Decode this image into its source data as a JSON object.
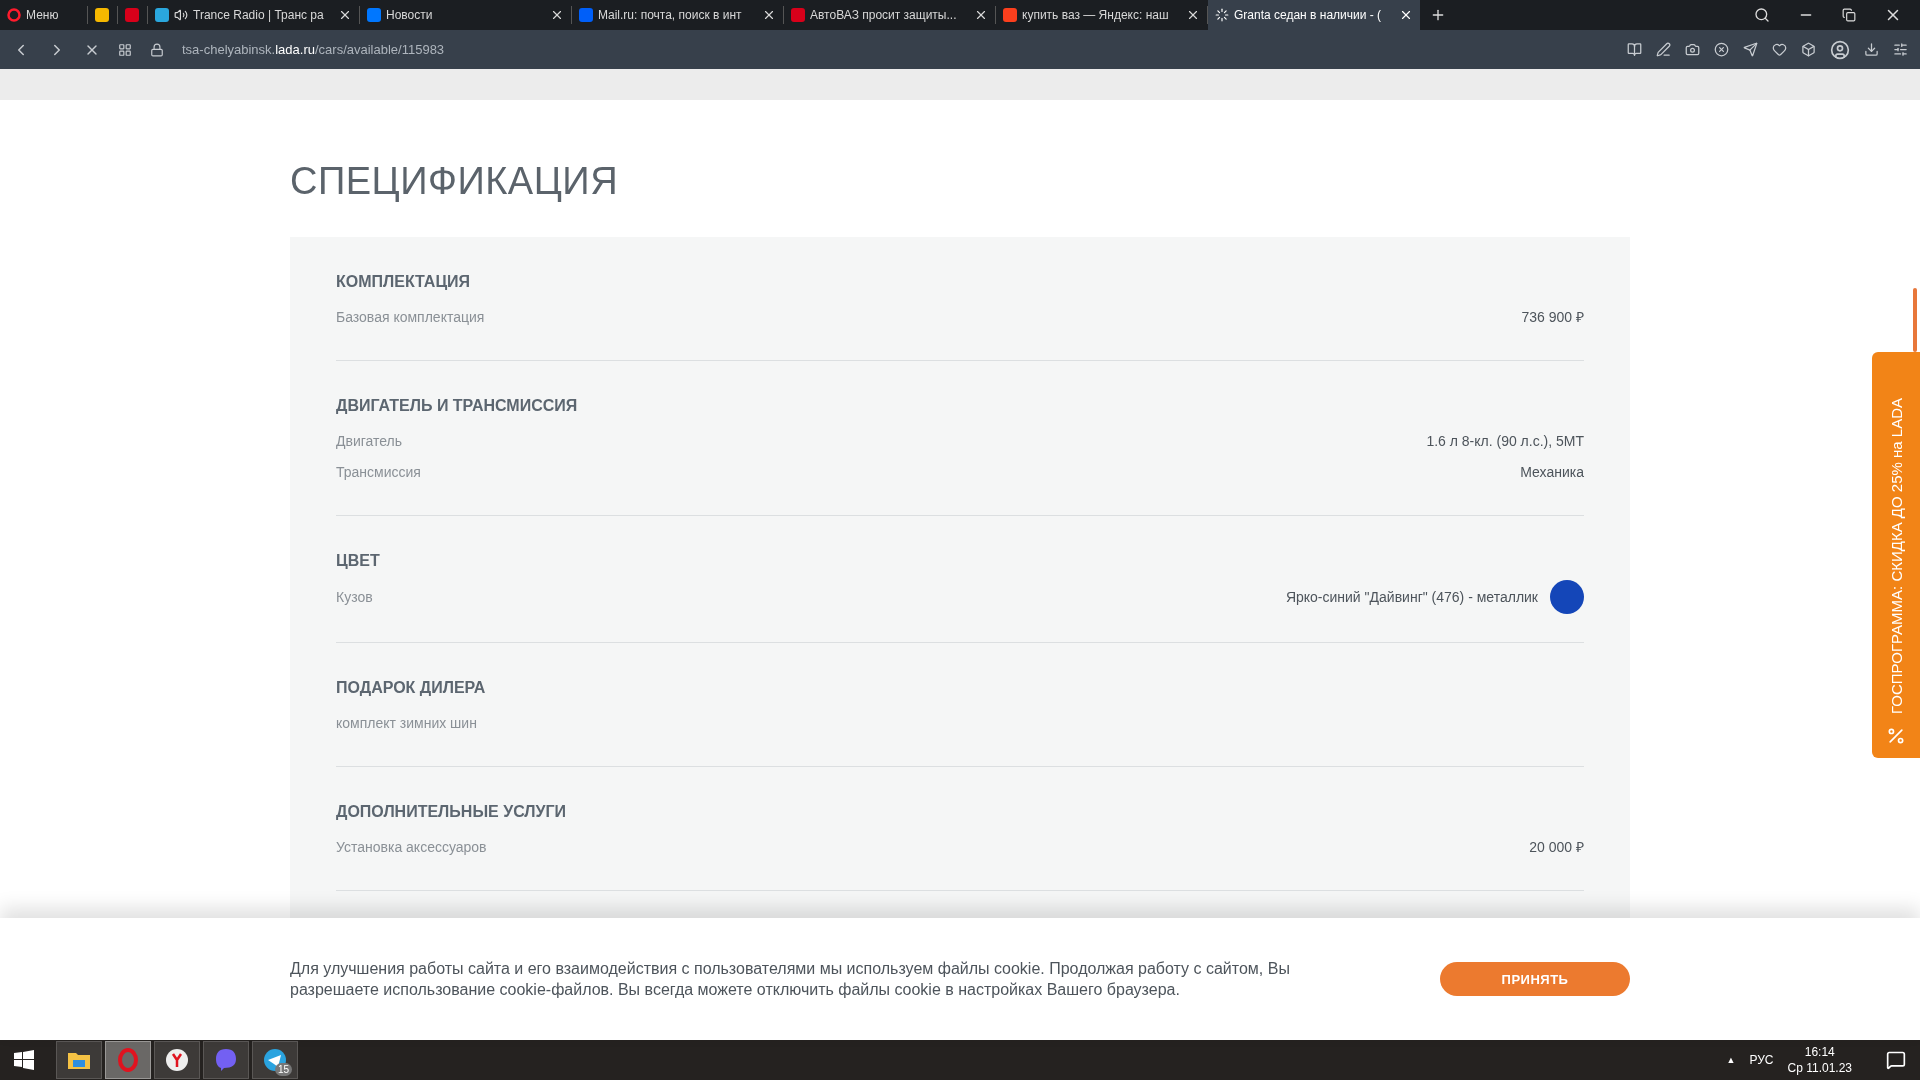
{
  "browser": {
    "tabs": [
      {
        "kind": "menu",
        "label": "Меню",
        "selected": false
      },
      {
        "kind": "pinned",
        "selected": false
      },
      {
        "kind": "pinned",
        "selected": false
      },
      {
        "kind": "page",
        "label": "Trance Radio | Транс ра",
        "selected": false,
        "audio": true
      },
      {
        "kind": "page",
        "label": "Новости",
        "selected": false
      },
      {
        "kind": "page",
        "label": "Mail.ru: почта, поиск в инт",
        "selected": false
      },
      {
        "kind": "page",
        "label": "АвтоВАЗ просит защиты...",
        "selected": false
      },
      {
        "kind": "page",
        "label": "купить ваз — Яндекс: наш",
        "selected": false
      },
      {
        "kind": "page",
        "label": "Granta седан в наличии - (",
        "selected": true,
        "loading": true
      }
    ],
    "url": "tsa-chelyabinsk.**lada.ru**/cars/available/115983"
  },
  "page": {
    "title": "СПЕЦИФИКАЦИЯ",
    "sections": [
      {
        "title": "КОМПЛЕКТАЦИЯ",
        "rows": [
          {
            "label": "Базовая комплектация",
            "value": "736 900 ₽"
          }
        ]
      },
      {
        "title": "ДВИГАТЕЛЬ И ТРАНСМИССИЯ",
        "rows": [
          {
            "label": "Двигатель",
            "value": "1.6 л 8-кл. (90 л.с.), 5МТ"
          },
          {
            "label": "Трансмиссия",
            "value": "Механика"
          }
        ]
      },
      {
        "title": "ЦВЕТ",
        "rows": [
          {
            "label": "Кузов",
            "value": "Ярко-синий \"Дайвинг\" (476) - металлик",
            "color": "#1446b8"
          }
        ]
      },
      {
        "title": "ПОДАРОК ДИЛЕРА",
        "rows": [
          {
            "label": "комплект зимних шин"
          }
        ]
      },
      {
        "title": "ДОПОЛНИТЕЛЬНЫЕ УСЛУГИ",
        "rows": [
          {
            "label": "Установка аксессуаров",
            "value": "20 000 ₽"
          }
        ]
      }
    ],
    "side_banner": "ГОСПРОГРАММА: СКИДКА ДО 25% на LADA"
  },
  "cookie_banner": {
    "text": "Для улучшения работы сайта и его взаимодействия с пользователями мы используем файлы cookie. Продолжая работу с сайтом, Вы разрешаете использование cookie-файлов. Вы всегда можете отключить файлы cookie в настройках Вашего браузера.",
    "button": "ПРИНЯТЬ"
  },
  "taskbar": {
    "apps": [
      {
        "selected": true
      },
      {
        "selected": false
      },
      {
        "selected": false
      },
      {
        "selected": false,
        "badge": "15"
      }
    ],
    "tray_arrow": "▲",
    "language": "РУС",
    "time": "16:14",
    "date": "Ср 11.01.23"
  }
}
